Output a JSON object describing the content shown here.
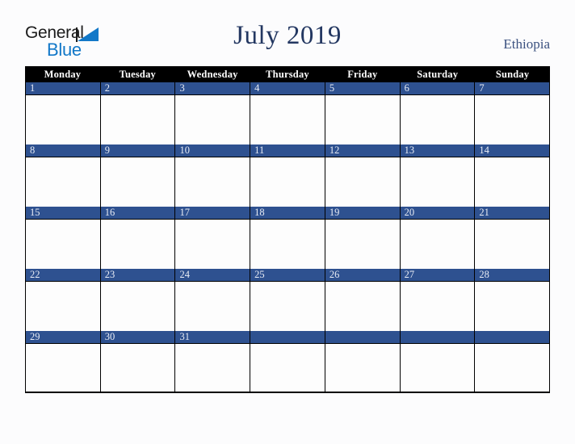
{
  "brand": {
    "name_part1": "General",
    "name_part2": "Blue",
    "triangle_icon": "blue-triangle-icon",
    "accent_color": "#1278c8",
    "text_color": "#1b1b1b"
  },
  "header": {
    "title": "July 2019",
    "country": "Ethiopia",
    "title_color": "#233761",
    "country_color": "#3c5280"
  },
  "calendar": {
    "month": "July",
    "year": "2019",
    "weekday_header_bg": "#000000",
    "weekday_header_color": "#ffffff",
    "date_bar_bg": "#2e5190",
    "date_bar_color": "#e8ecf5",
    "cell_bg": "#fdfdfd",
    "border_color": "#000000",
    "weekdays": [
      "Monday",
      "Tuesday",
      "Wednesday",
      "Thursday",
      "Friday",
      "Saturday",
      "Sunday"
    ],
    "weeks": [
      {
        "days": [
          {
            "number": "1",
            "events": ""
          },
          {
            "number": "2",
            "events": ""
          },
          {
            "number": "3",
            "events": ""
          },
          {
            "number": "4",
            "events": ""
          },
          {
            "number": "5",
            "events": ""
          },
          {
            "number": "6",
            "events": ""
          },
          {
            "number": "7",
            "events": ""
          }
        ]
      },
      {
        "days": [
          {
            "number": "8",
            "events": ""
          },
          {
            "number": "9",
            "events": ""
          },
          {
            "number": "10",
            "events": ""
          },
          {
            "number": "11",
            "events": ""
          },
          {
            "number": "12",
            "events": ""
          },
          {
            "number": "13",
            "events": ""
          },
          {
            "number": "14",
            "events": ""
          }
        ]
      },
      {
        "days": [
          {
            "number": "15",
            "events": ""
          },
          {
            "number": "16",
            "events": ""
          },
          {
            "number": "17",
            "events": ""
          },
          {
            "number": "18",
            "events": ""
          },
          {
            "number": "19",
            "events": ""
          },
          {
            "number": "20",
            "events": ""
          },
          {
            "number": "21",
            "events": ""
          }
        ]
      },
      {
        "days": [
          {
            "number": "22",
            "events": ""
          },
          {
            "number": "23",
            "events": ""
          },
          {
            "number": "24",
            "events": ""
          },
          {
            "number": "25",
            "events": ""
          },
          {
            "number": "26",
            "events": ""
          },
          {
            "number": "27",
            "events": ""
          },
          {
            "number": "28",
            "events": ""
          }
        ]
      },
      {
        "days": [
          {
            "number": "29",
            "events": ""
          },
          {
            "number": "30",
            "events": ""
          },
          {
            "number": "31",
            "events": ""
          },
          {
            "number": "",
            "events": ""
          },
          {
            "number": "",
            "events": ""
          },
          {
            "number": "",
            "events": ""
          },
          {
            "number": "",
            "events": ""
          }
        ]
      }
    ]
  }
}
